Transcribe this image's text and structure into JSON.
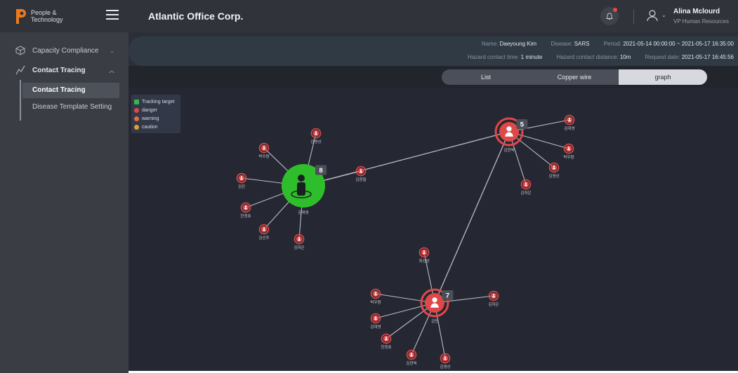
{
  "brand": {
    "line1": "People &",
    "line2": "Technology"
  },
  "header": {
    "company": "Atlantic Office Corp."
  },
  "user": {
    "name": "Alina Mclourd",
    "role": "VP Human Resources"
  },
  "sidebar": {
    "items": [
      {
        "label": "Capacity Compliance"
      },
      {
        "label": "Contact Tracing"
      }
    ],
    "subitems": [
      {
        "label": "Contact Tracing"
      },
      {
        "label": "Disease Template Setting"
      }
    ]
  },
  "info": {
    "name_label": "Name:",
    "name": "Daeyoung Kim",
    "disease_label": "Disease:",
    "disease": "SARS",
    "period_label": "Period:",
    "period": "2021-05-14 00:00:00 ~ 2021-05-17 16:35:00",
    "time_label": "Hazard contact time:",
    "time": "1 minute",
    "distance_label": "Hazard contact distance:",
    "distance": "10m",
    "request_label": "Request date:",
    "request": "2021-05-17 16:45:56"
  },
  "tabs": [
    {
      "label": "List"
    },
    {
      "label": "Copper wire"
    },
    {
      "label": "graph"
    }
  ],
  "legend": [
    {
      "label": "Tracking target",
      "color": "#35b84a"
    },
    {
      "label": "danger",
      "color": "#e04848"
    },
    {
      "label": "warning",
      "color": "#e07040"
    },
    {
      "label": "caution",
      "color": "#e0a030"
    }
  ],
  "colors": {
    "target": "#2fbe2b",
    "danger": "#e04848",
    "line": "#b8bcc6"
  },
  "graph": {
    "hubs": [
      {
        "id": "h1",
        "label": "김대영",
        "count": "8",
        "type": "target"
      },
      {
        "id": "h2",
        "label": "김현욱",
        "count": "5",
        "type": "danger"
      },
      {
        "id": "h3",
        "label": "김민",
        "count": "7",
        "type": "danger"
      }
    ],
    "nodes": [
      {
        "hub": "h1",
        "label": "김영상"
      },
      {
        "hub": "h1",
        "label": "박우람"
      },
      {
        "hub": "h1",
        "label": "김진"
      },
      {
        "hub": "h1",
        "label": "한정호"
      },
      {
        "hub": "h1",
        "label": "김선주"
      },
      {
        "hub": "h1",
        "label": "김하은"
      },
      {
        "hub": "h1",
        "label": "김환철"
      },
      {
        "hub": "h2",
        "label": "김대영"
      },
      {
        "hub": "h2",
        "label": "박우람"
      },
      {
        "hub": "h2",
        "label": "김영상"
      },
      {
        "hub": "h2",
        "label": "김하은"
      },
      {
        "hub": "h3",
        "label": "최선상"
      },
      {
        "hub": "h3",
        "label": "박우람"
      },
      {
        "hub": "h3",
        "label": "김대영"
      },
      {
        "hub": "h3",
        "label": "한정호"
      },
      {
        "hub": "h3",
        "label": "김현욱"
      },
      {
        "hub": "h3",
        "label": "김영상"
      },
      {
        "hub": "h3",
        "label": "김하은"
      }
    ],
    "links": [
      {
        "from": "h1",
        "to": "h2"
      },
      {
        "from": "h2",
        "to": "h3"
      }
    ]
  }
}
